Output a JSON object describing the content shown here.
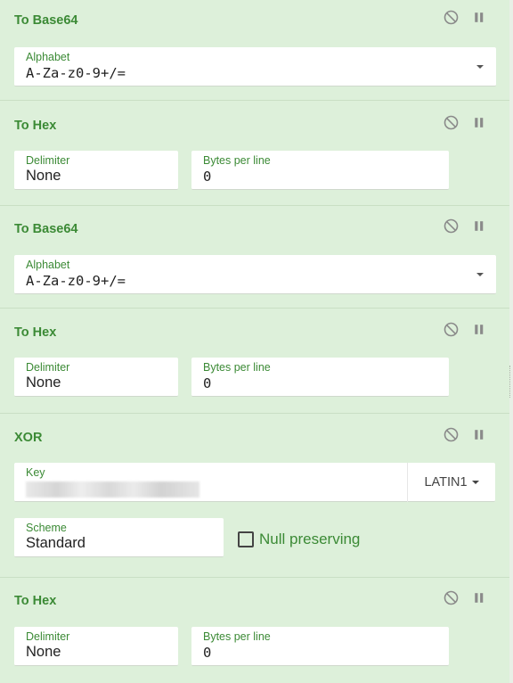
{
  "recipe": [
    {
      "title": "To Base64",
      "fields": [
        {
          "label": "Alphabet",
          "value": "A-Za-z0-9+/="
        }
      ]
    },
    {
      "title": "To Hex",
      "fields": [
        {
          "label": "Delimiter",
          "value": "None"
        },
        {
          "label": "Bytes per line",
          "value": "0"
        }
      ]
    },
    {
      "title": "To Base64",
      "fields": [
        {
          "label": "Alphabet",
          "value": "A-Za-z0-9+/="
        }
      ]
    },
    {
      "title": "To Hex",
      "fields": [
        {
          "label": "Delimiter",
          "value": "None"
        },
        {
          "label": "Bytes per line",
          "value": "0"
        }
      ]
    },
    {
      "title": "XOR",
      "key": {
        "label": "Key",
        "value": "",
        "encoding": "LATIN1"
      },
      "scheme": {
        "label": "Scheme",
        "value": "Standard"
      },
      "null_preserving": {
        "label": "Null preserving",
        "checked": false
      }
    },
    {
      "title": "To Hex",
      "fields": [
        {
          "label": "Delimiter",
          "value": "None"
        },
        {
          "label": "Bytes per line",
          "value": "0"
        }
      ]
    }
  ],
  "icons": {
    "disable": "disable-icon",
    "pause": "pause-icon"
  },
  "colors": {
    "title": "#3b8a35",
    "panel": "#ddf0da"
  }
}
